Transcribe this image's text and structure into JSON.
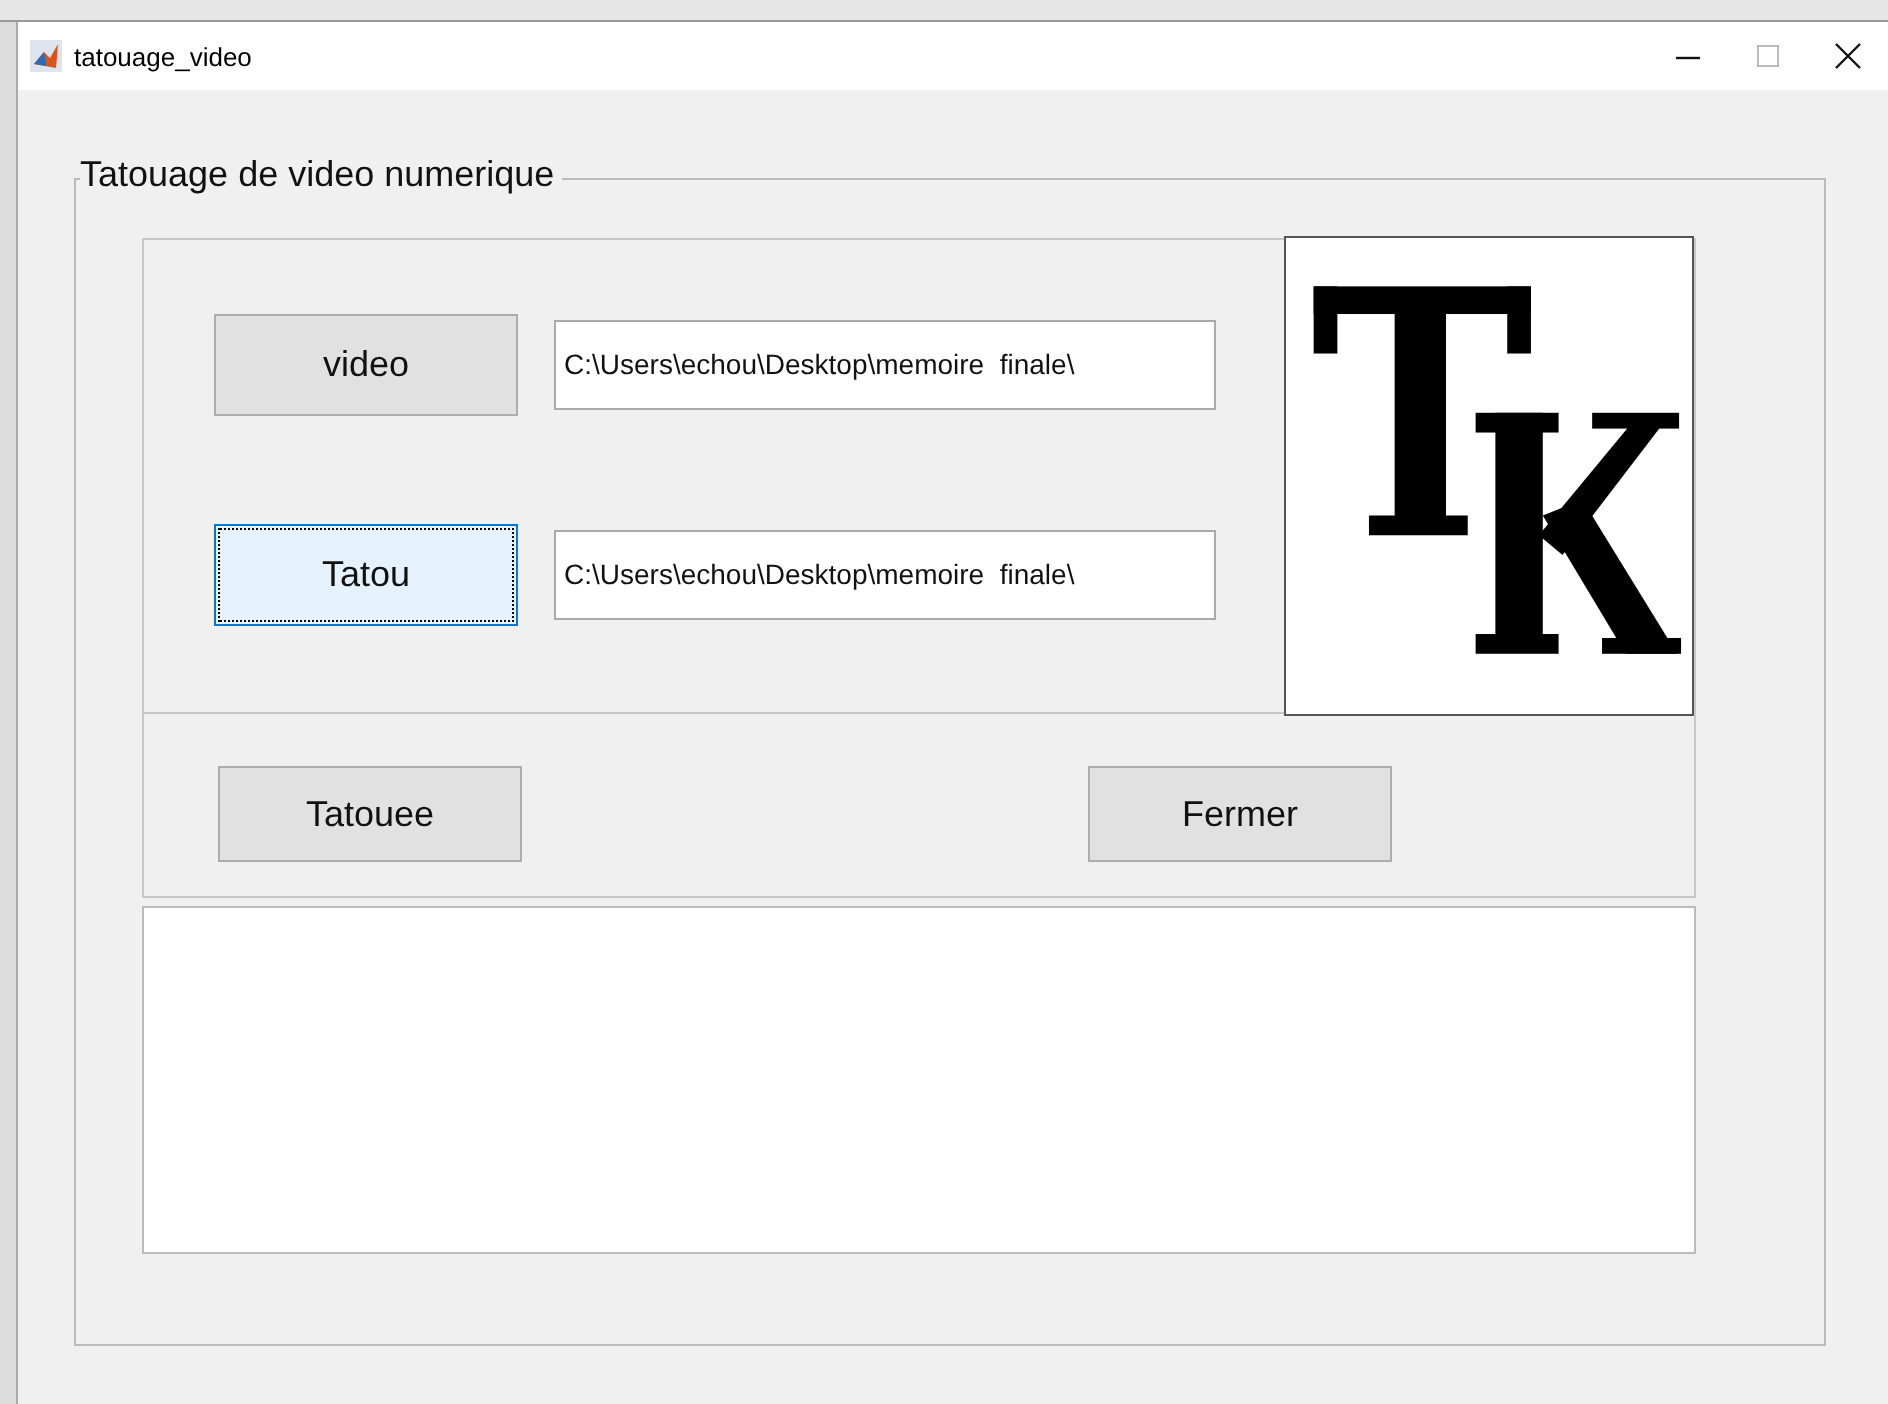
{
  "window": {
    "title": "tatouage_video"
  },
  "group": {
    "title": "Tatouage de video numerique"
  },
  "inputs": [
    {
      "button": {
        "label": "video",
        "focused": false
      },
      "path": "C:\\Users\\echou\\Desktop\\memoire  finale\\"
    },
    {
      "button": {
        "label": "Tatou",
        "focused": true
      },
      "path": "C:\\Users\\echou\\Desktop\\memoire  finale\\"
    }
  ],
  "actions": [
    {
      "label": "Tatouee"
    },
    {
      "label": "Fermer"
    }
  ]
}
